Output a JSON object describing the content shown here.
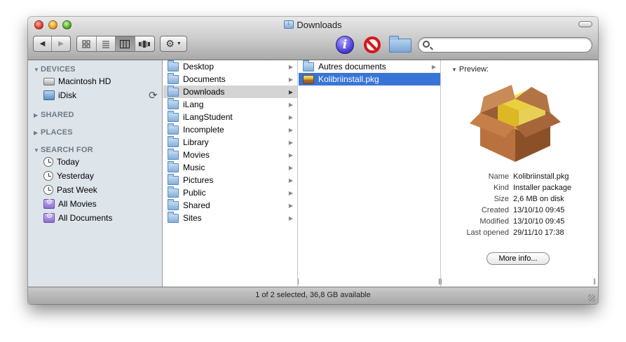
{
  "window": {
    "title": "Downloads"
  },
  "toolbar": {
    "nav": {
      "back": "◀",
      "forward": "▶"
    },
    "views": [
      "icon-view",
      "list-view",
      "column-view",
      "coverflow-view"
    ],
    "action_icon": "gear-icon",
    "search": {
      "value": "",
      "placeholder": ""
    },
    "icons": [
      "info-icon",
      "no-entry-icon",
      "new-folder-icon"
    ]
  },
  "sidebar": {
    "sections": {
      "devices": "DEVICES",
      "shared": "SHARED",
      "places": "PLACES",
      "search_for": "SEARCH FOR"
    },
    "devices": [
      {
        "label": "Macintosh HD",
        "icon": "hard-disk-icon"
      },
      {
        "label": "iDisk",
        "icon": "idisk-icon"
      }
    ],
    "search_for": [
      {
        "label": "Today",
        "icon": "clock-icon"
      },
      {
        "label": "Yesterday",
        "icon": "clock-icon"
      },
      {
        "label": "Past Week",
        "icon": "clock-icon"
      },
      {
        "label": "All Movies",
        "icon": "smart-folder-icon"
      },
      {
        "label": "All Documents",
        "icon": "smart-folder-icon"
      }
    ]
  },
  "columns": {
    "home": [
      "Desktop",
      "Documents",
      "Downloads",
      "iLang",
      "iLangStudent",
      "Incomplete",
      "Library",
      "Movies",
      "Music",
      "Pictures",
      "Public",
      "Shared",
      "Sites"
    ],
    "home_selected": "Downloads",
    "downloads": [
      "Autres documents",
      "Kolibriinstall.pkg"
    ],
    "downloads_selected": "Kolibriinstall.pkg"
  },
  "preview": {
    "heading": "Preview:",
    "meta": [
      {
        "key": "Name",
        "value": "Kolibriinstall.pkg"
      },
      {
        "key": "Kind",
        "value": "Installer package"
      },
      {
        "key": "Size",
        "value": "2,6 MB on disk"
      },
      {
        "key": "Created",
        "value": "13/10/10 09:45"
      },
      {
        "key": "Modified",
        "value": "13/10/10 09:45"
      },
      {
        "key": "Last opened",
        "value": "29/11/10 17:38"
      }
    ],
    "more_info": "More info..."
  },
  "status": {
    "text": "1 of 2 selected, 36,8 GB available"
  }
}
